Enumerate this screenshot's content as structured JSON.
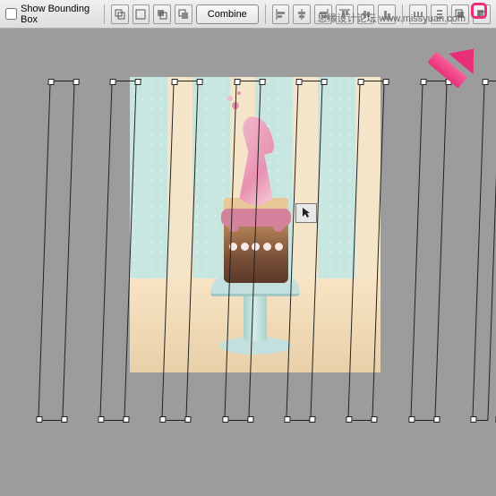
{
  "toolbar": {
    "show_bbox_label": "Show Bounding Box",
    "show_bbox_checked": false,
    "combine_label": "Combine"
  },
  "watermark": "思缘设计论坛 www.missyuan.com",
  "icons": {
    "path_mode_1": "path",
    "path_mode_2": "path",
    "path_mode_3": "path",
    "path_mode_4": "path",
    "align_1": "align",
    "align_2": "align",
    "align_3": "align",
    "align_4": "align",
    "align_5": "align",
    "align_6": "align",
    "arrange_1": "arrange",
    "arrange_2": "arrange",
    "arrange_3": "arrange",
    "arrange_4": "arrange",
    "gear": "gear"
  },
  "canvas": {
    "stripe_count": 8,
    "artwork_desc": "cake-on-stand-illustration"
  }
}
